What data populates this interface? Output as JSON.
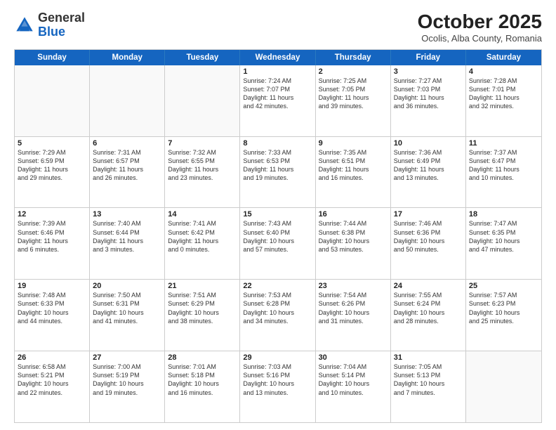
{
  "logo": {
    "general": "General",
    "blue": "Blue"
  },
  "header": {
    "month_title": "October 2025",
    "subtitle": "Ocolis, Alba County, Romania"
  },
  "weekdays": [
    "Sunday",
    "Monday",
    "Tuesday",
    "Wednesday",
    "Thursday",
    "Friday",
    "Saturday"
  ],
  "rows": [
    [
      {
        "day": "",
        "info": "",
        "empty": true
      },
      {
        "day": "",
        "info": "",
        "empty": true
      },
      {
        "day": "",
        "info": "",
        "empty": true
      },
      {
        "day": "1",
        "info": "Sunrise: 7:24 AM\nSunset: 7:07 PM\nDaylight: 11 hours\nand 42 minutes."
      },
      {
        "day": "2",
        "info": "Sunrise: 7:25 AM\nSunset: 7:05 PM\nDaylight: 11 hours\nand 39 minutes."
      },
      {
        "day": "3",
        "info": "Sunrise: 7:27 AM\nSunset: 7:03 PM\nDaylight: 11 hours\nand 36 minutes."
      },
      {
        "day": "4",
        "info": "Sunrise: 7:28 AM\nSunset: 7:01 PM\nDaylight: 11 hours\nand 32 minutes."
      }
    ],
    [
      {
        "day": "5",
        "info": "Sunrise: 7:29 AM\nSunset: 6:59 PM\nDaylight: 11 hours\nand 29 minutes."
      },
      {
        "day": "6",
        "info": "Sunrise: 7:31 AM\nSunset: 6:57 PM\nDaylight: 11 hours\nand 26 minutes."
      },
      {
        "day": "7",
        "info": "Sunrise: 7:32 AM\nSunset: 6:55 PM\nDaylight: 11 hours\nand 23 minutes."
      },
      {
        "day": "8",
        "info": "Sunrise: 7:33 AM\nSunset: 6:53 PM\nDaylight: 11 hours\nand 19 minutes."
      },
      {
        "day": "9",
        "info": "Sunrise: 7:35 AM\nSunset: 6:51 PM\nDaylight: 11 hours\nand 16 minutes."
      },
      {
        "day": "10",
        "info": "Sunrise: 7:36 AM\nSunset: 6:49 PM\nDaylight: 11 hours\nand 13 minutes."
      },
      {
        "day": "11",
        "info": "Sunrise: 7:37 AM\nSunset: 6:47 PM\nDaylight: 11 hours\nand 10 minutes."
      }
    ],
    [
      {
        "day": "12",
        "info": "Sunrise: 7:39 AM\nSunset: 6:46 PM\nDaylight: 11 hours\nand 6 minutes."
      },
      {
        "day": "13",
        "info": "Sunrise: 7:40 AM\nSunset: 6:44 PM\nDaylight: 11 hours\nand 3 minutes."
      },
      {
        "day": "14",
        "info": "Sunrise: 7:41 AM\nSunset: 6:42 PM\nDaylight: 11 hours\nand 0 minutes."
      },
      {
        "day": "15",
        "info": "Sunrise: 7:43 AM\nSunset: 6:40 PM\nDaylight: 10 hours\nand 57 minutes."
      },
      {
        "day": "16",
        "info": "Sunrise: 7:44 AM\nSunset: 6:38 PM\nDaylight: 10 hours\nand 53 minutes."
      },
      {
        "day": "17",
        "info": "Sunrise: 7:46 AM\nSunset: 6:36 PM\nDaylight: 10 hours\nand 50 minutes."
      },
      {
        "day": "18",
        "info": "Sunrise: 7:47 AM\nSunset: 6:35 PM\nDaylight: 10 hours\nand 47 minutes."
      }
    ],
    [
      {
        "day": "19",
        "info": "Sunrise: 7:48 AM\nSunset: 6:33 PM\nDaylight: 10 hours\nand 44 minutes."
      },
      {
        "day": "20",
        "info": "Sunrise: 7:50 AM\nSunset: 6:31 PM\nDaylight: 10 hours\nand 41 minutes."
      },
      {
        "day": "21",
        "info": "Sunrise: 7:51 AM\nSunset: 6:29 PM\nDaylight: 10 hours\nand 38 minutes."
      },
      {
        "day": "22",
        "info": "Sunrise: 7:53 AM\nSunset: 6:28 PM\nDaylight: 10 hours\nand 34 minutes."
      },
      {
        "day": "23",
        "info": "Sunrise: 7:54 AM\nSunset: 6:26 PM\nDaylight: 10 hours\nand 31 minutes."
      },
      {
        "day": "24",
        "info": "Sunrise: 7:55 AM\nSunset: 6:24 PM\nDaylight: 10 hours\nand 28 minutes."
      },
      {
        "day": "25",
        "info": "Sunrise: 7:57 AM\nSunset: 6:23 PM\nDaylight: 10 hours\nand 25 minutes."
      }
    ],
    [
      {
        "day": "26",
        "info": "Sunrise: 6:58 AM\nSunset: 5:21 PM\nDaylight: 10 hours\nand 22 minutes."
      },
      {
        "day": "27",
        "info": "Sunrise: 7:00 AM\nSunset: 5:19 PM\nDaylight: 10 hours\nand 19 minutes."
      },
      {
        "day": "28",
        "info": "Sunrise: 7:01 AM\nSunset: 5:18 PM\nDaylight: 10 hours\nand 16 minutes."
      },
      {
        "day": "29",
        "info": "Sunrise: 7:03 AM\nSunset: 5:16 PM\nDaylight: 10 hours\nand 13 minutes."
      },
      {
        "day": "30",
        "info": "Sunrise: 7:04 AM\nSunset: 5:14 PM\nDaylight: 10 hours\nand 10 minutes."
      },
      {
        "day": "31",
        "info": "Sunrise: 7:05 AM\nSunset: 5:13 PM\nDaylight: 10 hours\nand 7 minutes."
      },
      {
        "day": "",
        "info": "",
        "empty": true
      }
    ]
  ]
}
